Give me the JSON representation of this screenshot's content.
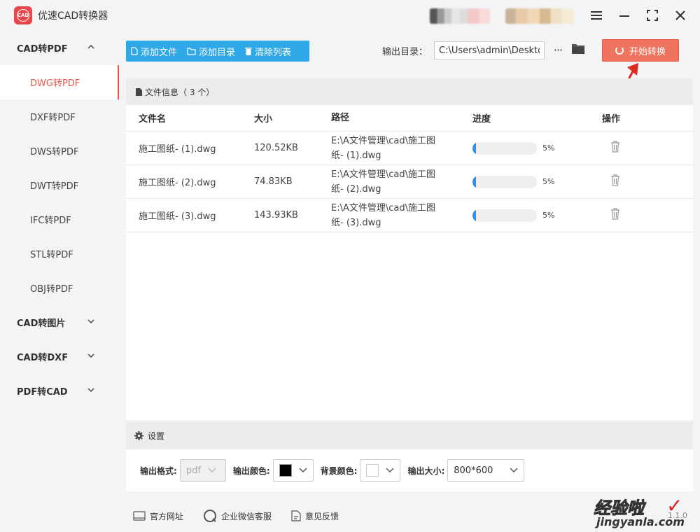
{
  "app": {
    "title": "优速CAD转换器",
    "logo_text": "CAD"
  },
  "sidebar": {
    "groups": [
      {
        "label": "CAD转PDF",
        "expanded": true,
        "items": [
          {
            "label": "DWG转PDF",
            "active": true
          },
          {
            "label": "DXF转PDF"
          },
          {
            "label": "DWS转PDF"
          },
          {
            "label": "DWT转PDF"
          },
          {
            "label": "IFC转PDF"
          },
          {
            "label": "STL转PDF"
          },
          {
            "label": "OBJ转PDF"
          }
        ]
      },
      {
        "label": "CAD转图片",
        "expanded": false
      },
      {
        "label": "CAD转DXF",
        "expanded": false
      },
      {
        "label": "PDF转CAD",
        "expanded": false
      }
    ]
  },
  "toolbar": {
    "add_file": "添加文件",
    "add_dir": "添加目录",
    "clear_list": "清除列表",
    "output_label": "输出目录：",
    "output_path": "C:\\Users\\admin\\Desktop",
    "more": "···",
    "start": "开始转换",
    "accent": "#2ea8e6",
    "start_color": "#f0735f"
  },
  "files": {
    "header": "文件信息（ 3 个）",
    "columns": {
      "name": "文件名",
      "size": "大小",
      "path": "路径",
      "progress": "进度",
      "ops": "操作"
    },
    "rows": [
      {
        "name": "施工图纸- (1).dwg",
        "size": "120.52KB",
        "path1": "E:\\A文件管理\\cad\\施工图",
        "path2": "纸- (1).dwg",
        "progress": 0.05,
        "pct": "5%"
      },
      {
        "name": "施工图纸- (2).dwg",
        "size": "74.83KB",
        "path1": "E:\\A文件管理\\cad\\施工图",
        "path2": "纸- (2).dwg",
        "progress": 0.05,
        "pct": "5%"
      },
      {
        "name": "施工图纸- (3).dwg",
        "size": "143.93KB",
        "path1": "E:\\A文件管理\\cad\\施工图",
        "path2": "纸- (3).dwg",
        "progress": 0.05,
        "pct": "5%"
      }
    ]
  },
  "settings": {
    "title": "设置",
    "format_label": "输出格式:",
    "format_value": "pdf",
    "color_label": "输出颜色:",
    "color_value": "#000000",
    "bg_label": "背景颜色:",
    "bg_value": "#ffffff",
    "size_label": "输出大小:",
    "size_value": "800*600"
  },
  "footer": {
    "website": "官方网址",
    "wechat": "企业微信客服",
    "feedback": "意见反馈",
    "version": "1.1.0"
  },
  "watermark": {
    "line1": "经验啦",
    "line2": "jingyanla.com"
  }
}
